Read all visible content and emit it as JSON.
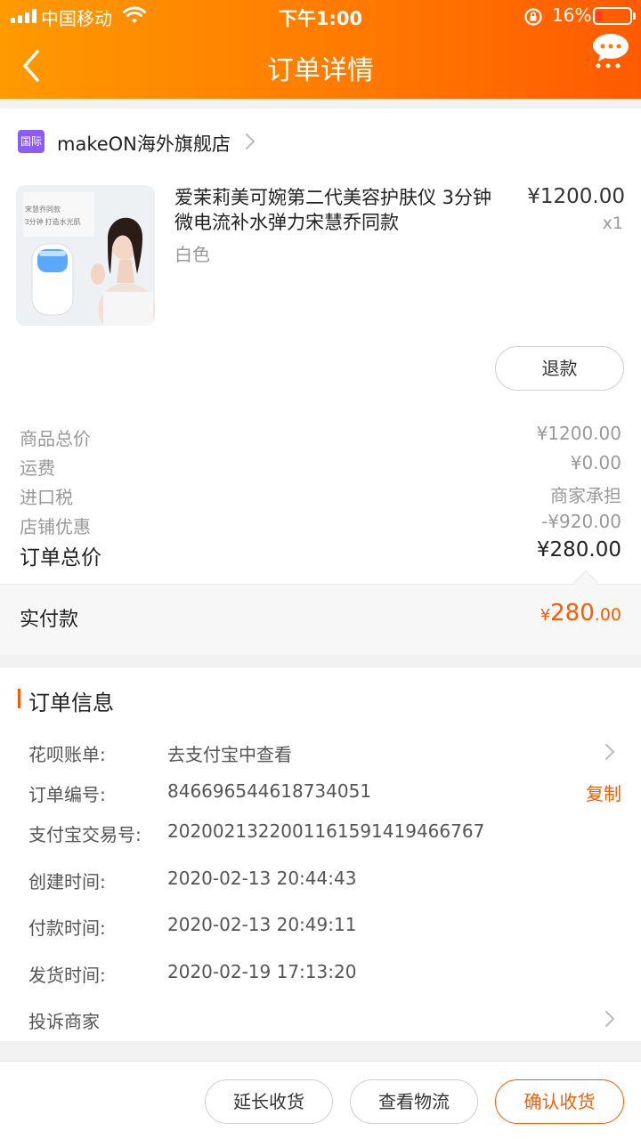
{
  "status_bar": {
    "carrier": "中国移动",
    "time": "下午1:00",
    "battery": "16%",
    "battery_level": 0.16
  },
  "nav": {
    "title": "订单详情"
  },
  "shop": {
    "tag": "国际",
    "name": "makeON海外旗舰店"
  },
  "product": {
    "title": "爱茉莉美可婉第二代美容护肤仪 3分钟微电流补水弹力宋慧乔同款",
    "spec": "白色",
    "price": "¥1200.00",
    "qty": "x1",
    "image_caption_1": "宋慧乔同款",
    "image_caption_2": "3分钟 打造水光肌",
    "refund_label": "退款"
  },
  "summary": {
    "rows": [
      {
        "label": "商品总价",
        "value": "¥1200.00"
      },
      {
        "label": "运费",
        "value": "¥0.00"
      },
      {
        "label": "进口税",
        "value": "商家承担"
      },
      {
        "label": "店铺优惠",
        "value": "-¥920.00"
      }
    ],
    "total_label": "订单总价",
    "total_value": "¥280.00",
    "paid_label": "实付款",
    "paid_currency": "¥",
    "paid_int": "280",
    "paid_dec": ".00"
  },
  "order_info": {
    "title": "订单信息",
    "rows": [
      {
        "label": "花呗账单:",
        "value": "去支付宝中查看"
      },
      {
        "label": "订单编号:",
        "value": "846696544618734051"
      },
      {
        "label": "支付宝交易号:",
        "value": "2020021322001161591419466767"
      },
      {
        "label": "创建时间:",
        "value": "2020-02-13 20:44:43"
      },
      {
        "label": "付款时间:",
        "value": "2020-02-13 20:49:11"
      },
      {
        "label": "发货时间:",
        "value": "2020-02-19 17:13:20"
      }
    ],
    "copy_label": "复制",
    "complain_label": "投诉商家"
  },
  "actions": {
    "extend": "延长收货",
    "logistics": "查看物流",
    "confirm": "确认收货"
  },
  "colors": {
    "accent": "#ff5a00",
    "header_start": "#ff9a00",
    "header_end": "#ff5a00"
  }
}
